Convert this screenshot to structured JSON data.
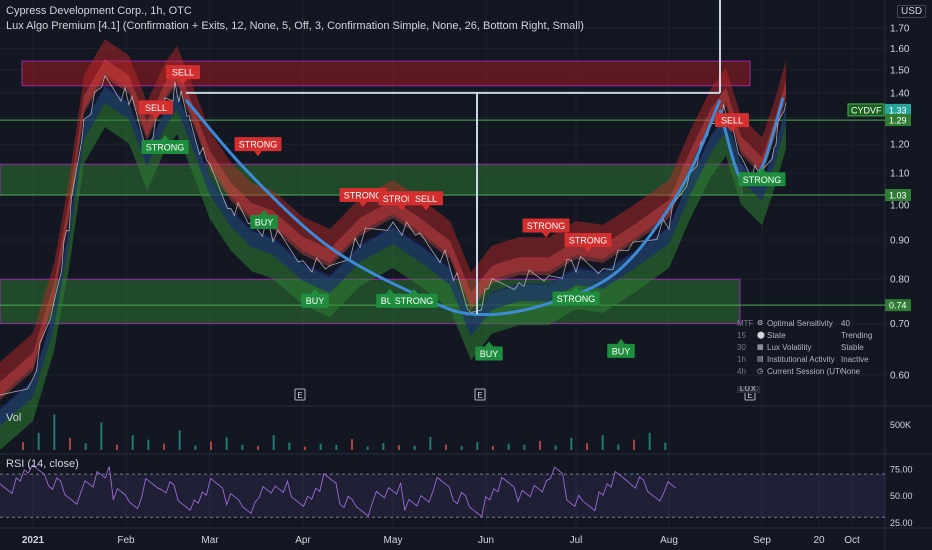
{
  "header": {
    "title": "Cypress Development Corp., 1h, OTC",
    "indicator": "Lux Algo Premium [4.1] (Confirmation + Exits, 12, None, 5, Off, 3, Confirmation Simple, None, 26, Bottom Right, Small)",
    "currency_button": "USD"
  },
  "panes": {
    "volume_label": "Vol",
    "rsi_label": "RSI (14, close)"
  },
  "colors": {
    "background": "#131722",
    "support_zone": "#2e7d32",
    "resistance_zone": "#b71c1c",
    "level_line": "#4caf50",
    "cup_curve": "#3d8ad6",
    "buy_label": "#1e8e3e",
    "sell_label": "#d32f2f",
    "rsi": "#9c6bd6"
  },
  "chart_data": [
    {
      "type": "line",
      "title": "Cypress Development Corp., 1h, OTC",
      "y_scale": "log",
      "ylim": [
        0.55,
        1.85
      ],
      "y_ticks": [
        0.6,
        0.7,
        0.8,
        0.9,
        1.0,
        1.1,
        1.2,
        1.3,
        1.4,
        1.5,
        1.6,
        1.7
      ],
      "y_tick_labels": [
        "0.60",
        "0.70",
        "0.80",
        "0.90",
        "1.00",
        "1.10",
        "1.20",
        "1.30",
        "1.40",
        "1.50",
        "1.60",
        "1.70"
      ],
      "x_tick_labels": [
        "2021",
        "Feb",
        "Mar",
        "Apr",
        "May",
        "Jun",
        "Jul",
        "Aug",
        "Sep",
        "20",
        "Oct"
      ],
      "x_tick_dates": [
        "2021-01-01",
        "2021-02-01",
        "2021-03-01",
        "2021-04-01",
        "2021-05-01",
        "2021-06-01",
        "2021-07-01",
        "2021-08-01",
        "2021-09-01",
        "2021-09-20",
        "2021-10-01"
      ],
      "grid": true,
      "series": [
        {
          "dates": [
            "2020-12-21",
            "2021-01-01",
            "2021-01-08",
            "2021-01-13",
            "2021-01-18",
            "2021-01-25",
            "2021-02-02",
            "2021-02-08",
            "2021-02-14",
            "2021-02-18",
            "2021-02-22",
            "2021-03-01",
            "2021-03-08",
            "2021-03-15",
            "2021-03-22",
            "2021-04-01",
            "2021-04-10",
            "2021-04-20",
            "2021-05-01",
            "2021-05-10",
            "2021-05-20",
            "2021-05-27",
            "2021-06-03",
            "2021-06-12",
            "2021-06-22",
            "2021-07-01",
            "2021-07-10",
            "2021-07-20",
            "2021-08-01",
            "2021-08-08",
            "2021-08-15",
            "2021-08-20",
            "2021-08-25",
            "2021-09-01",
            "2021-09-05",
            "2021-09-09"
          ],
          "values": [
            0.55,
            0.6,
            0.74,
            0.95,
            1.3,
            1.45,
            1.38,
            1.2,
            1.35,
            1.42,
            1.3,
            1.1,
            1.0,
            0.94,
            0.92,
            0.85,
            0.82,
            0.9,
            0.95,
            0.9,
            0.84,
            0.72,
            0.78,
            0.8,
            0.8,
            0.84,
            0.83,
            0.88,
            0.95,
            1.1,
            1.25,
            1.33,
            1.15,
            1.08,
            1.2,
            1.36
          ]
        }
      ],
      "current_price": {
        "ticker": "CYDVF",
        "value": 1.33
      },
      "price_levels": [
        1.29,
        1.03,
        0.74
      ],
      "resistance_zone": [
        1.43,
        1.54
      ],
      "support_zones": [
        [
          1.03,
          1.13
        ],
        [
          0.7,
          0.8
        ]
      ],
      "cup_curve": {
        "dates": [
          "2021-02-21",
          "2021-03-14",
          "2021-04-10",
          "2021-05-10",
          "2021-05-28",
          "2021-06-20",
          "2021-07-15",
          "2021-08-05",
          "2021-08-18"
        ],
        "values": [
          1.37,
          1.1,
          0.88,
          0.76,
          0.72,
          0.74,
          0.82,
          1.05,
          1.37
        ]
      },
      "handle_curve": {
        "dates": [
          "2021-08-18",
          "2021-08-25",
          "2021-09-01",
          "2021-09-08"
        ],
        "values": [
          1.33,
          1.08,
          1.12,
          1.38
        ]
      },
      "annotations": [
        {
          "text": "SELL",
          "date": "2021-02-11",
          "value": 1.34,
          "kind": "sell"
        },
        {
          "text": "SELL",
          "date": "2021-02-20",
          "value": 1.49,
          "kind": "sell"
        },
        {
          "text": "STRONG",
          "date": "2021-02-14",
          "value": 1.19,
          "kind": "buy"
        },
        {
          "text": "STRONG",
          "date": "2021-03-17",
          "value": 1.2,
          "kind": "sell"
        },
        {
          "text": "BUY",
          "date": "2021-03-19",
          "value": 0.95,
          "kind": "buy"
        },
        {
          "text": "STRONG",
          "date": "2021-04-21",
          "value": 1.03,
          "kind": "sell"
        },
        {
          "text": "STRONG",
          "date": "2021-05-04",
          "value": 1.02,
          "kind": "sell"
        },
        {
          "text": "SELL",
          "date": "2021-05-12",
          "value": 1.02,
          "kind": "sell"
        },
        {
          "text": "BUY",
          "date": "2021-04-05",
          "value": 0.75,
          "kind": "buy"
        },
        {
          "text": "BUY",
          "date": "2021-04-30",
          "value": 0.75,
          "kind": "buy"
        },
        {
          "text": "STRONG",
          "date": "2021-05-08",
          "value": 0.75,
          "kind": "buy"
        },
        {
          "text": "BUY",
          "date": "2021-06-02",
          "value": 0.64,
          "kind": "buy"
        },
        {
          "text": "STRONG",
          "date": "2021-06-21",
          "value": 0.94,
          "kind": "sell"
        },
        {
          "text": "STRONG",
          "date": "2021-07-05",
          "value": 0.9,
          "kind": "sell"
        },
        {
          "text": "STRONG",
          "date": "2021-07-01",
          "value": 0.755,
          "kind": "buy"
        },
        {
          "text": "BUY",
          "date": "2021-07-16",
          "value": 0.645,
          "kind": "buy"
        },
        {
          "text": "SELL",
          "date": "2021-08-22",
          "value": 1.29,
          "kind": "sell"
        },
        {
          "text": "STRONG",
          "date": "2021-09-01",
          "value": 1.08,
          "kind": "buy"
        }
      ],
      "earnings_markers": [
        {
          "text": "E",
          "date": "2021-03-31"
        },
        {
          "text": "E",
          "date": "2021-05-30"
        },
        {
          "text": "E",
          "date": "2021-08-28"
        }
      ]
    },
    {
      "type": "bar",
      "title": "Vol",
      "y_ticks": [
        500000
      ],
      "y_tick_labels": [
        "500K"
      ],
      "values": [
        140000,
        300000,
        620000,
        210000,
        120000,
        480000,
        95000,
        260000,
        180000,
        110000,
        340000,
        80000,
        150000,
        220000,
        90000,
        70000,
        260000,
        130000,
        60000,
        110000,
        90000,
        190000,
        60000,
        120000,
        85000,
        75000,
        230000,
        95000,
        65000,
        140000,
        70000,
        110000,
        90000,
        160000,
        80000,
        210000,
        120000,
        260000,
        95000,
        180000,
        300000,
        130000
      ]
    },
    {
      "type": "line",
      "title": "RSI (14, close)",
      "ylim": [
        20,
        85
      ],
      "y_ticks": [
        25,
        50,
        75
      ],
      "y_tick_labels": [
        "25.00",
        "50.00",
        "75.00"
      ],
      "bands": [
        30,
        70
      ],
      "values": [
        55,
        68,
        74,
        62,
        48,
        58,
        71,
        52,
        44,
        60,
        57,
        41,
        49,
        63,
        46,
        38,
        54,
        59,
        43,
        51,
        66,
        45,
        37,
        48,
        56,
        42,
        50,
        61,
        47,
        35,
        52,
        64,
        49,
        58,
        72,
        46,
        39,
        55,
        68,
        63,
        51,
        57
      ]
    }
  ],
  "lux_table": {
    "rows": [
      {
        "tf": "MTF",
        "icon": "gauge-icon",
        "glyph": "⚙",
        "name": "Optimal Sensitivity",
        "value": "40"
      },
      {
        "tf": "15",
        "icon": "state-icon",
        "glyph": "⬤",
        "name": "State",
        "value": "Trending"
      },
      {
        "tf": "30",
        "icon": "volatility-icon",
        "glyph": "▦",
        "name": "Lux Volatility",
        "value": "Stable"
      },
      {
        "tf": "1h",
        "icon": "institution-icon",
        "glyph": "▤",
        "name": "Institutional Activity",
        "value": "Inactive"
      },
      {
        "tf": "4h",
        "icon": "clock-icon",
        "glyph": "◷",
        "name": "Current Session (UTC)",
        "value": "None"
      }
    ],
    "logo": "LUX"
  }
}
